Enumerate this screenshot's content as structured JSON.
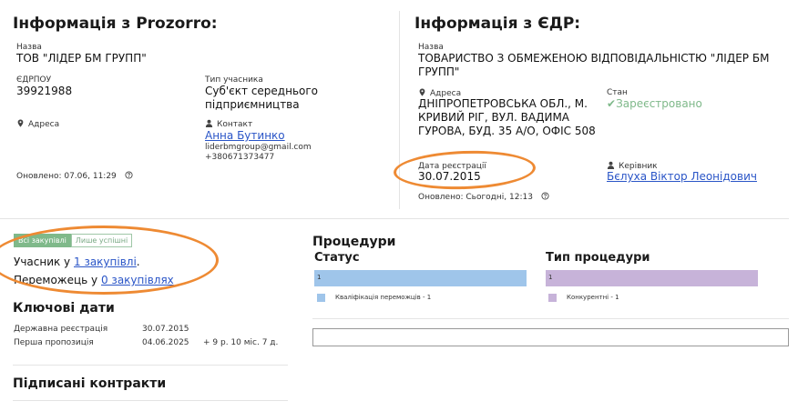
{
  "prozorro": {
    "title": "Інформація з Prozorro:",
    "name_label": "Назва",
    "name": "ТОВ \"ЛІДЕР БМ ГРУПП\"",
    "edrpou_label": "ЄДРПОУ",
    "edrpou": "39921988",
    "participant_type_label": "Тип учасника",
    "participant_type": "Суб'єкт середнього підприємництва",
    "address_label": "Адреса",
    "contact_label": "Контакт",
    "contact_name": "Анна Бутинко",
    "contact_email": "liderbmgroup@gmail.com",
    "contact_phone": "+380671373477",
    "updated": "Оновлено: 07.06, 11:29"
  },
  "edr": {
    "title": "Інформація з ЄДР:",
    "name_label": "Назва",
    "name": "ТОВАРИСТВО З ОБМЕЖЕНОЮ ВІДПОВІДАЛЬНІСТЮ \"ЛІДЕР БМ ГРУПП\"",
    "address_label": "Адреса",
    "address": "ДНІПРОПЕТРОВСЬКА ОБЛ., М. КРИВИЙ РІГ, ВУЛ. ВАДИМА ГУРОВА, БУД. 35 А/О, ОФІС 508",
    "status_label": "Стан",
    "status": "Зареєстровано",
    "reg_date_label": "Дата реєстрації",
    "reg_date": "30.07.2015",
    "head_label": "Керівник",
    "head": "Бєлуха Віктор Леонідович",
    "updated": "Оновлено: Сьогодні, 12:13"
  },
  "filters": {
    "all": "Всі закупівлі",
    "success": "Лише успішні"
  },
  "participation": {
    "participant_prefix": "Учасник у",
    "participant_link": "1 закупівлі",
    "participant_suffix": ".",
    "winner_prefix": "Переможець у",
    "winner_link": "0 закупівлях"
  },
  "key_dates": {
    "title": "Ключові дати",
    "rows": [
      {
        "label": "Державна реєстрація",
        "date": "30.07.2015",
        "extra": ""
      },
      {
        "label": "Перша пропозиція",
        "date": "04.06.2025",
        "extra": "+ 9 р. 10 міс. 7 д."
      }
    ]
  },
  "contracts": {
    "title": "Підписані контракти"
  },
  "procedures": {
    "title": "Процедури",
    "status_title": "Статус",
    "type_title": "Тип процедури"
  },
  "colors": {
    "status_bar": "#9fc5ea",
    "type_bar": "#c7b3d9",
    "accent_link": "#2a55c7",
    "annotation": "#ee8a33",
    "status_ok": "#7fb98a"
  },
  "chart_data": [
    {
      "type": "bar",
      "title": "Статус",
      "categories": [
        "Кваліфікація переможців"
      ],
      "values": [
        1
      ],
      "legend": [
        "Кваліфікація переможців - 1"
      ]
    },
    {
      "type": "bar",
      "title": "Тип процедури",
      "categories": [
        "Конкурентні"
      ],
      "values": [
        1
      ],
      "legend": [
        "Конкурентні - 1"
      ]
    }
  ]
}
